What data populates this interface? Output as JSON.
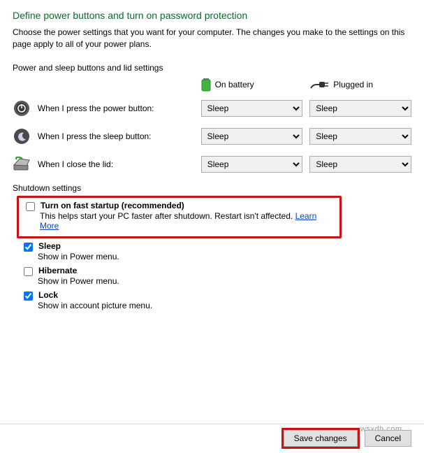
{
  "title": "Define power buttons and turn on password protection",
  "description": "Choose the power settings that you want for your computer. The changes you make to the settings on this page apply to all of your power plans.",
  "section_power_buttons": "Power and sleep buttons and lid settings",
  "columns": {
    "battery": "On battery",
    "plugged": "Plugged in"
  },
  "rows": {
    "power": {
      "label": "When I press the power button:",
      "battery": "Sleep",
      "plugged": "Sleep"
    },
    "sleep": {
      "label": "When I press the sleep button:",
      "battery": "Sleep",
      "plugged": "Sleep"
    },
    "lid": {
      "label": "When I close the lid:",
      "battery": "Sleep",
      "plugged": "Sleep"
    }
  },
  "shutdown_head": "Shutdown settings",
  "fast_startup": {
    "checked": false,
    "label": "Turn on fast startup (recommended)",
    "sub": "This helps start your PC faster after shutdown. Restart isn't affected.",
    "learn": "Learn More"
  },
  "sleep_opt": {
    "checked": true,
    "label": "Sleep",
    "sub": "Show in Power menu."
  },
  "hibernate_opt": {
    "checked": false,
    "label": "Hibernate",
    "sub": "Show in Power menu."
  },
  "lock_opt": {
    "checked": true,
    "label": "Lock",
    "sub": "Show in account picture menu."
  },
  "buttons": {
    "save": "Save changes",
    "cancel": "Cancel"
  },
  "watermark": "wsxdh.com"
}
